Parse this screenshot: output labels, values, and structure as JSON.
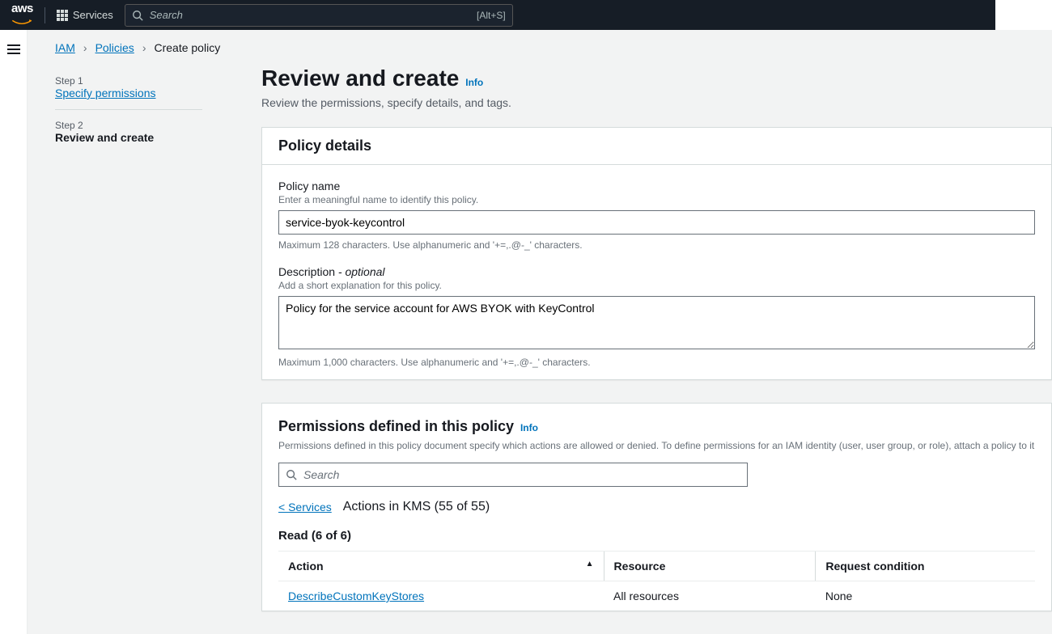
{
  "nav": {
    "logo_text": "aws",
    "services_label": "Services",
    "search_placeholder": "Search",
    "search_kbd": "[Alt+S]"
  },
  "breadcrumbs": {
    "items": [
      "IAM",
      "Policies"
    ],
    "current": "Create policy"
  },
  "steps": {
    "step1_label": "Step 1",
    "step1_title": "Specify permissions",
    "step2_label": "Step 2",
    "step2_title": "Review and create"
  },
  "main": {
    "title": "Review and create",
    "info": "Info",
    "desc": "Review the permissions, specify details, and tags."
  },
  "policy_details": {
    "panel_title": "Policy details",
    "name_label": "Policy name",
    "name_help": "Enter a meaningful name to identify this policy.",
    "name_value": "service-byok-keycontrol",
    "name_constraint": "Maximum 128 characters. Use alphanumeric and '+=,.@-_' characters.",
    "desc_label": "Description",
    "desc_optional": " - optional",
    "desc_help": "Add a short explanation for this policy.",
    "desc_value": "Policy for the service account for AWS BYOK with KeyControl",
    "desc_constraint": "Maximum 1,000 characters. Use alphanumeric and '+=,.@-_' characters."
  },
  "permissions": {
    "title": "Permissions defined in this policy",
    "info": "Info",
    "desc": "Permissions defined in this policy document specify which actions are allowed or denied. To define permissions for an IAM identity (user, user group, or role), attach a policy to it",
    "search_placeholder": "Search",
    "services_back": "< Services",
    "actions_in": "Actions in KMS (55 of 55)",
    "group": "Read (6 of 6)",
    "columns": {
      "action": "Action",
      "resource": "Resource",
      "condition": "Request condition"
    },
    "rows": [
      {
        "action": "DescribeCustomKeyStores",
        "resource": "All resources",
        "condition": "None"
      }
    ]
  }
}
